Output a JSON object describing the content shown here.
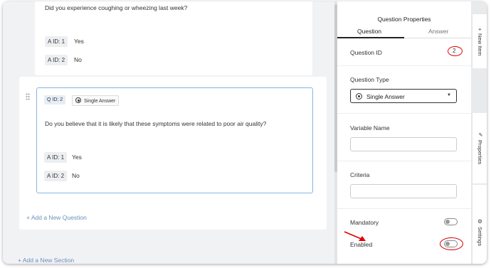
{
  "question_list": {
    "q1": {
      "text": "Did you experience coughing or wheezing last week?",
      "answers": [
        {
          "id_label": "A ID: 1",
          "text": "Yes"
        },
        {
          "id_label": "A ID: 2",
          "text": "No"
        }
      ]
    },
    "q2": {
      "id_label": "Q ID: 2",
      "type_label": "Single Answer",
      "text": "Do you believe that it is likely that these symptoms were related to poor air quality?",
      "answers": [
        {
          "id_label": "A ID: 1",
          "text": "Yes"
        },
        {
          "id_label": "A ID: 2",
          "text": "No"
        }
      ]
    },
    "add_question": "+ Add a New Question",
    "add_section": "+ Add a New Section"
  },
  "properties_panel": {
    "title": "Question Properties",
    "tabs": [
      "Question",
      "Answer"
    ],
    "question_id_label": "Question ID",
    "question_id_value": "2",
    "question_type_label": "Question Type",
    "question_type_value": "Single Answer",
    "variable_name_label": "Variable Name",
    "variable_name_value": "",
    "criteria_label": "Criteria",
    "criteria_value": "",
    "mandatory_label": "Mandatory",
    "mandatory_on": false,
    "enabled_label": "Enabled",
    "enabled_on": false
  },
  "side_tabs": [
    {
      "label": "New Item",
      "icon": "plus-icon"
    },
    {
      "label": "Properties",
      "icon": "pin-icon"
    },
    {
      "label": "Settings",
      "icon": "gear-icon"
    }
  ],
  "annotation_color": "#dd0000"
}
